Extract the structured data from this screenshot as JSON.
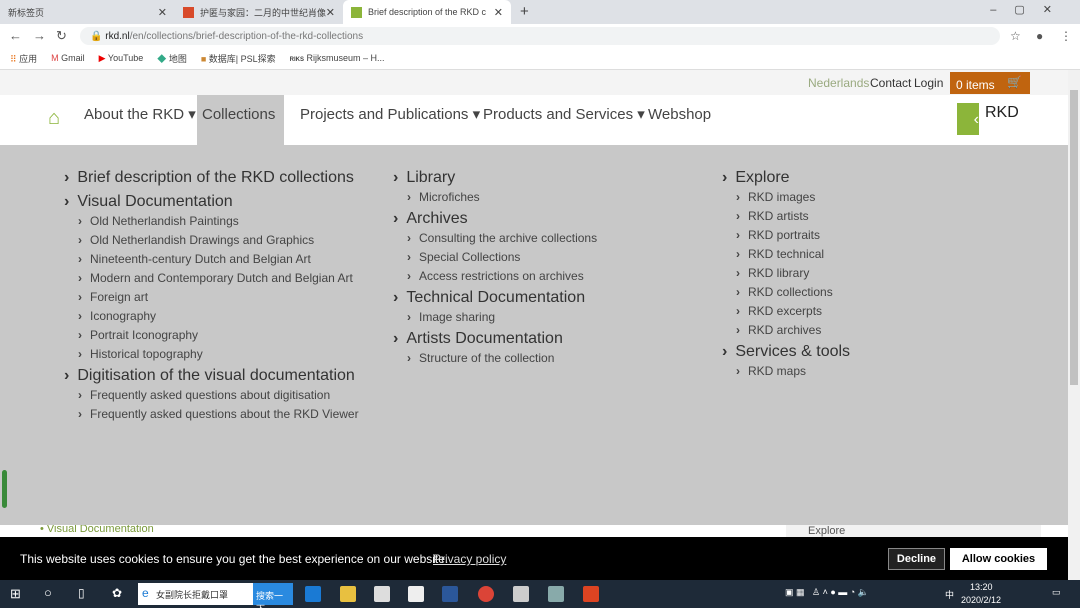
{
  "browser": {
    "tabs": [
      {
        "label": "新标签页"
      },
      {
        "label": "护匿与家园：二月的中世纪肖像"
      },
      {
        "label": "Brief description of the RKD c"
      }
    ],
    "url_domain": "rkd.nl",
    "url_path": "/en/collections/brief-description-of-the-rkd-collections",
    "bookmarks": [
      "应用",
      "Gmail",
      "YouTube",
      "地图",
      "数据库| PSL探索",
      "Rijksmuseum – H..."
    ]
  },
  "util": {
    "language": "Nederlands",
    "contact": "Contact",
    "login": "Login",
    "cart": "0 items"
  },
  "nav": {
    "items": [
      "About the RKD",
      "Collections",
      "Projects and Publications",
      "Products and Services",
      "Webshop"
    ],
    "logo": "RKD"
  },
  "menu": {
    "columns": [
      [
        {
          "h": "Brief description of the RKD collections",
          "s": []
        },
        {
          "h": "Visual Documentation",
          "s": [
            "Old Netherlandish Paintings",
            "Old Netherlandish Drawings and Graphics",
            "Nineteenth-century Dutch and Belgian Art",
            "Modern and Contemporary Dutch and Belgian Art",
            "Foreign art",
            "Iconography",
            "Portrait Iconography",
            "Historical topography"
          ]
        },
        {
          "h": "Digitisation of the visual documentation",
          "s": [
            "Frequently asked questions about digitisation",
            "Frequently asked questions about the RKD Viewer"
          ]
        }
      ],
      [
        {
          "h": "Library",
          "s": [
            "Microfiches"
          ]
        },
        {
          "h": "Archives",
          "s": [
            "Consulting the archive collections",
            "Special Collections",
            "Access restrictions on archives"
          ]
        },
        {
          "h": "Technical Documentation",
          "s": [
            "Image sharing"
          ]
        },
        {
          "h": "Artists Documentation",
          "s": [
            "Structure of the collection"
          ]
        }
      ],
      [
        {
          "h": "Explore",
          "s": [
            "RKD images",
            "RKD artists",
            "RKD portraits",
            "RKD technical",
            "RKD library",
            "RKD collections",
            "RKD excerpts",
            "RKD archives"
          ]
        },
        {
          "h": "Services & tools",
          "s": [
            "RKD maps"
          ]
        }
      ]
    ]
  },
  "below": {
    "left": "Visual Documentation",
    "right": "Explore"
  },
  "cookie": {
    "text": "This website uses cookies to ensure you get the best experience on our website.",
    "policy": "Privacy policy",
    "decline": "Decline",
    "allow": "Allow cookies"
  },
  "taskbar": {
    "search": "女副院长拒戴口罩",
    "search_btn": "搜索一下",
    "time": "13:20",
    "date": "2020/2/12",
    "ime": "中"
  }
}
